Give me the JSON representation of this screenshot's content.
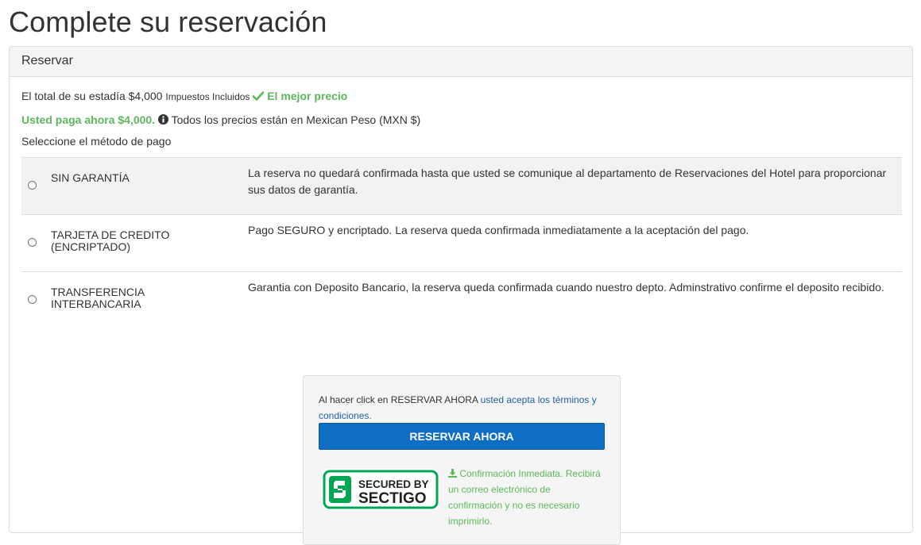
{
  "page": {
    "title": "Complete su reservación"
  },
  "panel": {
    "heading": "Reservar"
  },
  "summary": {
    "total_text": "El total de su estadía $4,000",
    "taxes_note": "Impuestos Incluidos",
    "best_price": "El mejor precio",
    "pay_now": "Usted paga ahora $4,000.",
    "currency_note": "Todos los precios están en Mexican Peso (MXN $)",
    "select_method": "Seleccione el método de pago"
  },
  "payment_methods": [
    {
      "label": "SIN GARANTÍA",
      "description": "La reserva no quedará confirmada hasta que usted se comunique al departamento de Reservaciones del Hotel para proporcionar sus datos de garantía.",
      "selected": false
    },
    {
      "label": "TARJETA DE CREDITO (ENCRIPTADO)",
      "description": "Pago SEGURO y encriptado. La reserva queda confirmada inmediatamente a la aceptación del pago.",
      "selected": false
    },
    {
      "label": "TRANSFERENCIA INTERBANCARIA",
      "description": "Garantia con Deposito Bancario, la reserva queda confirmada cuando nuestro depto. Adminstrativo confirme el deposito recibido.",
      "selected": false
    }
  ],
  "confirm": {
    "terms_prefix": "Al hacer click en RESERVAR AHORA",
    "terms_link": "usted acepta los términos y condiciones.",
    "button_label": "RESERVAR AHORA",
    "badge_line1": "SECURED BY",
    "badge_line2": "SECTIGO",
    "note": "Confirmación Inmediata. Recibirá un correo electrónico de confirmación y no es necesario imprimirlo."
  },
  "colors": {
    "accent_green": "#5cb85c",
    "button_blue": "#0d6ec4",
    "link_blue": "#1f5fa8",
    "sectigo_green": "#00a651"
  },
  "icons": [
    "check-icon",
    "info-icon",
    "download-icon",
    "sectigo-logo-icon"
  ]
}
